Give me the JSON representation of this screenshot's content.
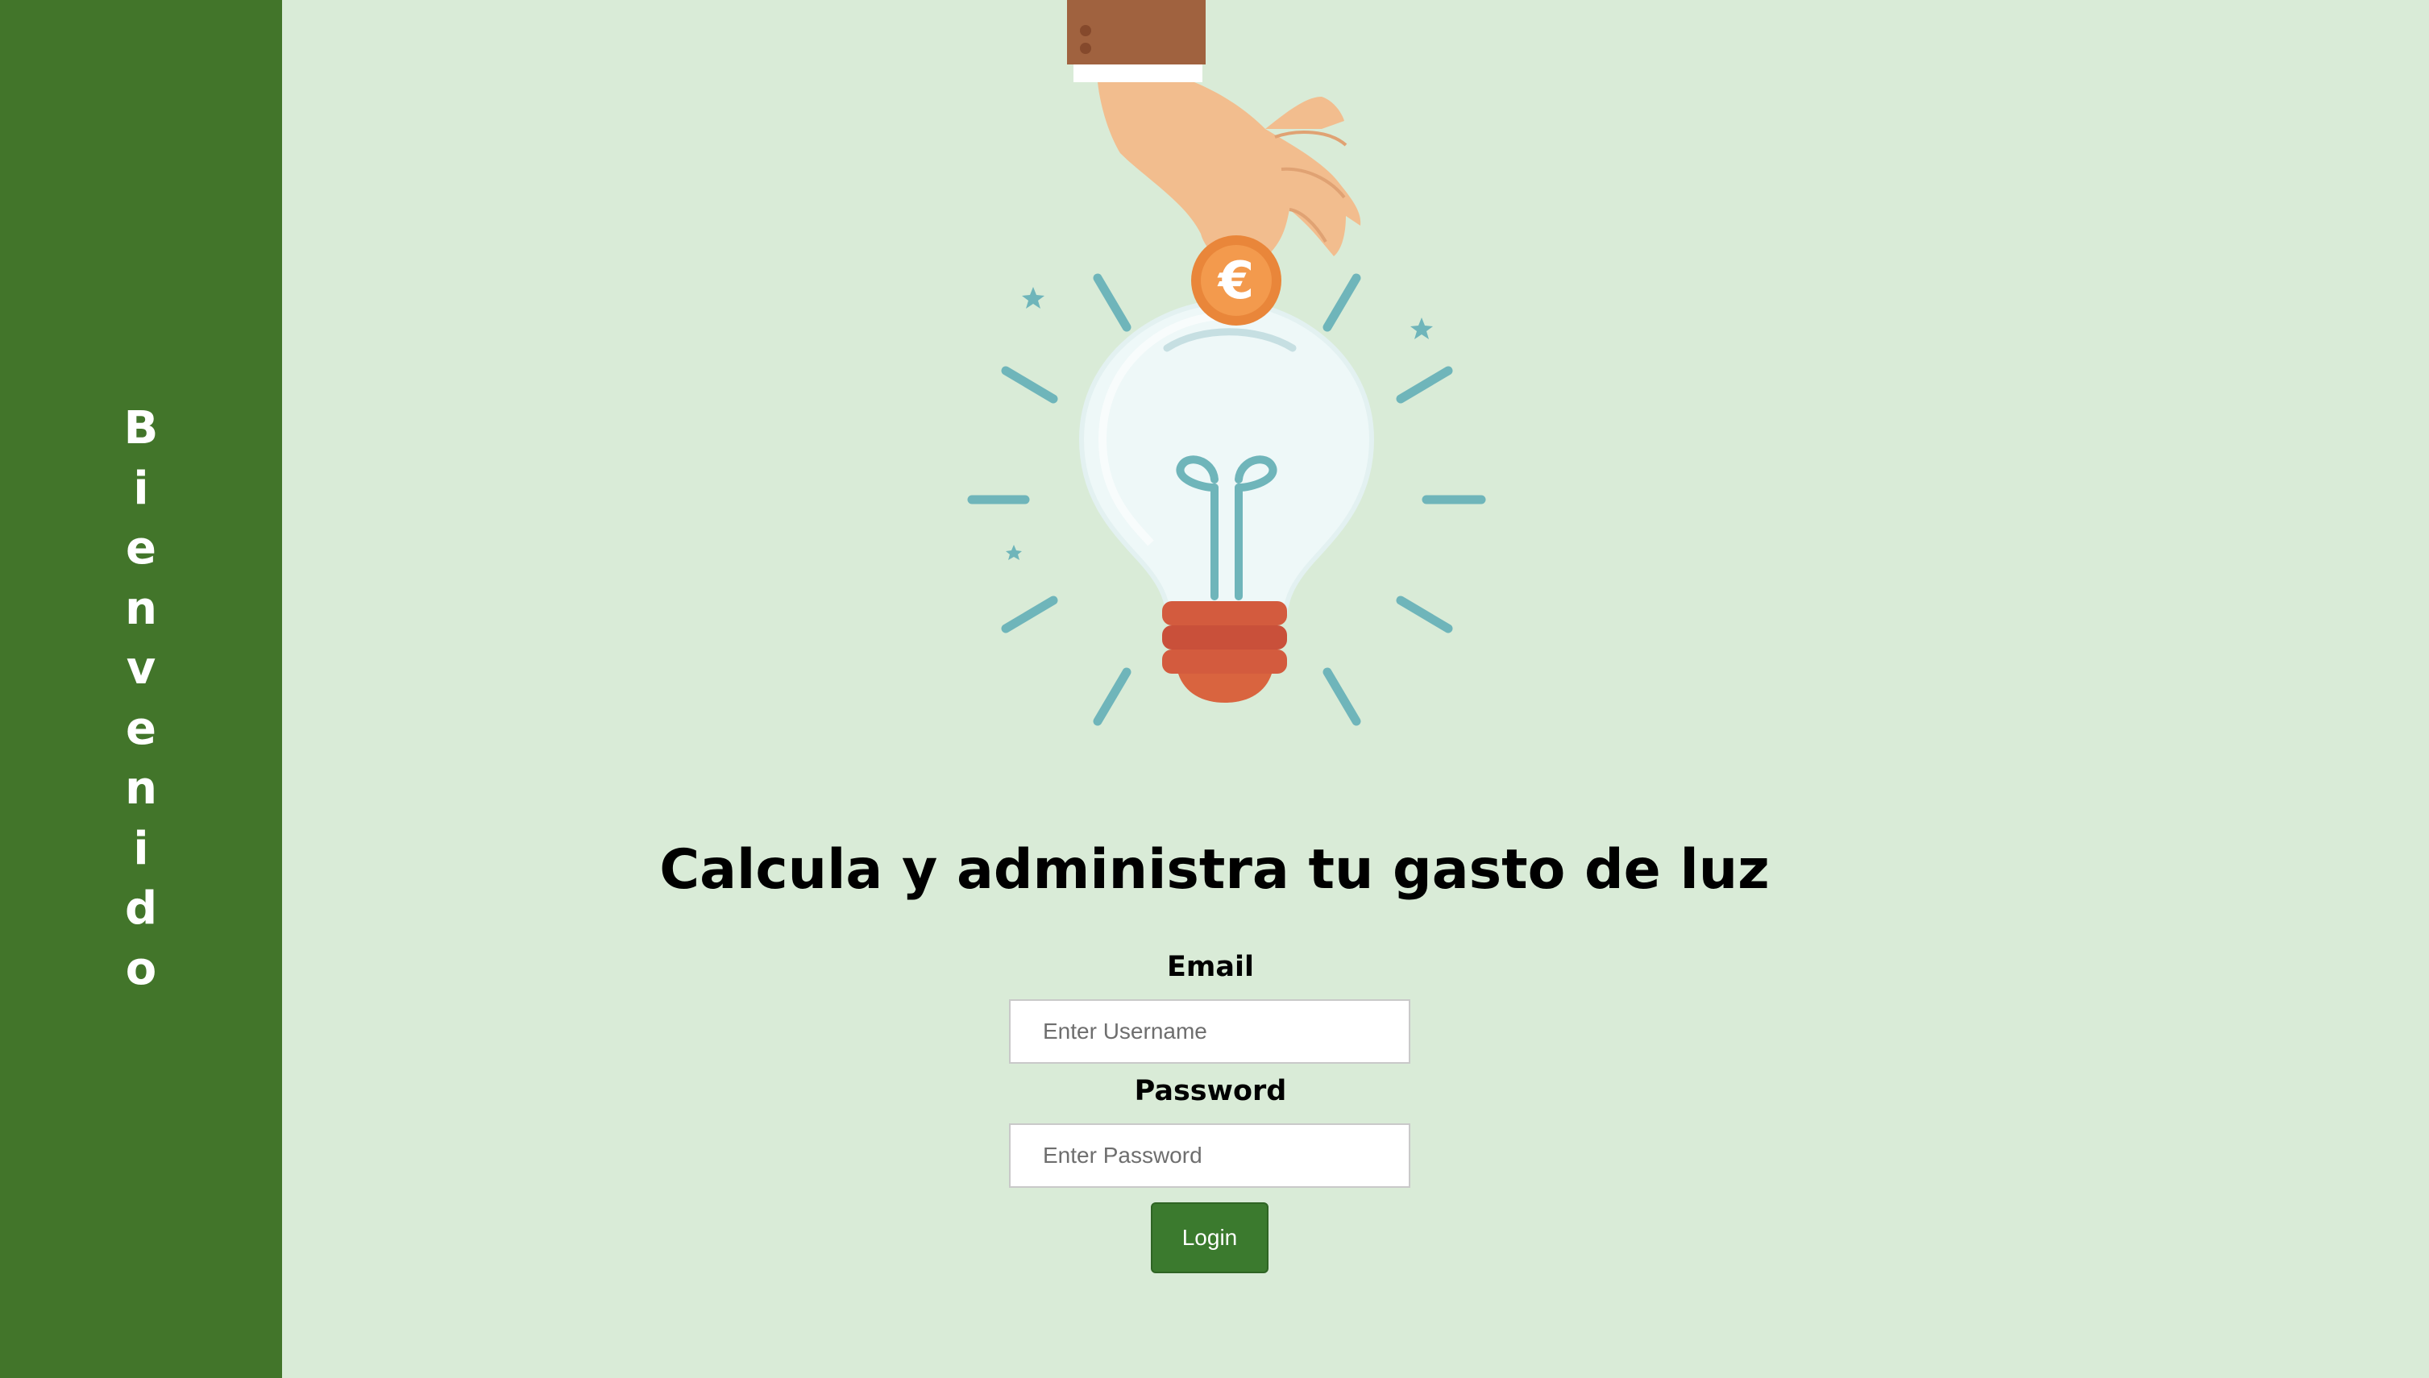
{
  "sidebar": {
    "letters": [
      "B",
      "i",
      "e",
      "n",
      "v",
      "e",
      "n",
      "i",
      "d",
      "o"
    ]
  },
  "main": {
    "headline": "Calcula y administra tu gasto de luz",
    "email_label": "Email",
    "email_placeholder": "Enter Username",
    "password_label": "Password",
    "password_placeholder": "Enter Password",
    "login_label": "Login"
  },
  "illustration": {
    "icon": "lightbulb-coin-icon",
    "coin_symbol": "€"
  },
  "colors": {
    "sidebar": "#42752a",
    "background": "#d9ebd7",
    "button": "#3b7a2e"
  }
}
